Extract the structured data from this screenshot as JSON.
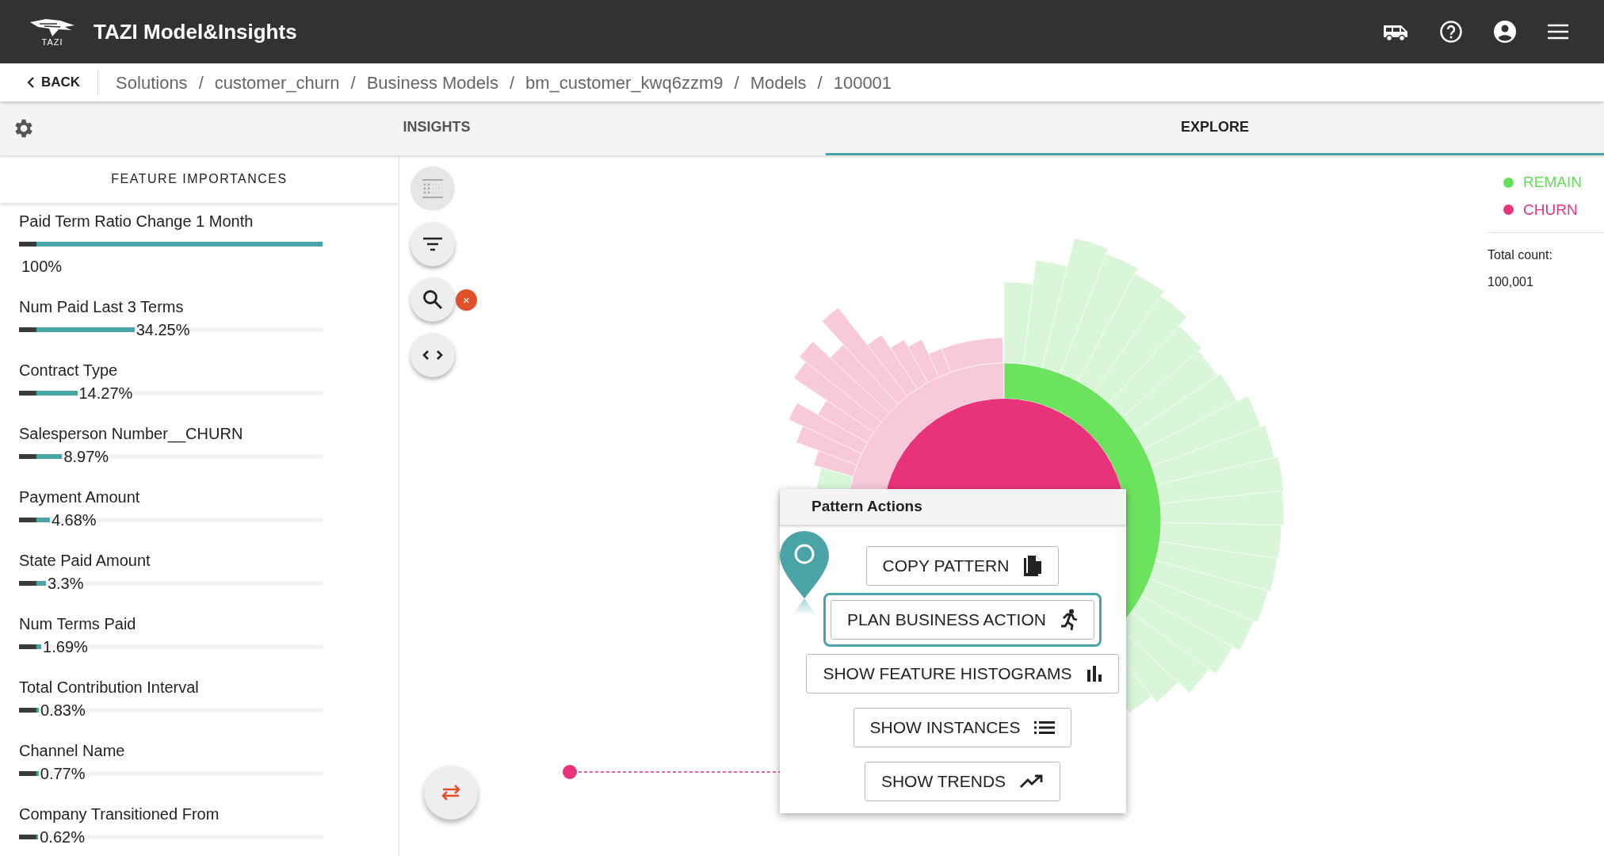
{
  "app": {
    "logo_text": "TAZI",
    "title": "TAZI Model&Insights"
  },
  "nav": {
    "back": "BACK",
    "separators": [
      "/",
      "/",
      "/",
      "/",
      "/"
    ],
    "breadcrumbs": [
      "Solutions",
      "customer_churn",
      "Business Models",
      "bm_customer_kwq6zzm9",
      "Models",
      "100001"
    ]
  },
  "tabs": [
    {
      "label": "INSIGHTS",
      "selected": false
    },
    {
      "label": "EXPLORE",
      "selected": true
    }
  ],
  "feature_importances": {
    "title": "FEATURE IMPORTANCES",
    "items": [
      {
        "name": "Paid Term Ratio Change 1 Month",
        "value": "100%",
        "level": 1
      },
      {
        "name": "Num Paid Last 3 Terms",
        "value": "34.25%",
        "level": 0.3425
      },
      {
        "name": "Contract Type",
        "value": "14.27%",
        "level": 0.1427
      },
      {
        "name": "Salesperson Number__CHURN",
        "value": "8.97%",
        "level": 0.0897
      },
      {
        "name": "Payment Amount",
        "value": "4.68%",
        "level": 0.0468
      },
      {
        "name": "State Paid Amount",
        "value": "3.3%",
        "level": 0.033
      },
      {
        "name": "Num Terms Paid",
        "value": "1.69%",
        "level": 0.0169
      },
      {
        "name": "Total Contribution Interval",
        "value": "0.83%",
        "level": 0.0083
      },
      {
        "name": "Channel Name",
        "value": "0.77%",
        "level": 0.0077
      },
      {
        "name": "Company Transitioned From",
        "value": "0.62%",
        "level": 0.0062
      }
    ]
  },
  "toolbar": {
    "search_clear": "×"
  },
  "legend": {
    "items": [
      {
        "label": "REMAIN",
        "color": "#63e05a"
      },
      {
        "label": "CHURN",
        "color": "#e8337a"
      }
    ],
    "total_label": "Total count:",
    "total_value": "100,001"
  },
  "pattern_actions": {
    "title": "Pattern Actions",
    "buttons": [
      {
        "label": "COPY PATTERN",
        "kind": "copy",
        "selected": false
      },
      {
        "label": "PLAN BUSINESS ACTION",
        "kind": "run",
        "selected": true
      },
      {
        "label": "SHOW FEATURE HISTOGRAMS",
        "kind": "histogram",
        "selected": false
      },
      {
        "label": "SHOW INSTANCES",
        "kind": "list",
        "selected": false
      },
      {
        "label": "SHOW TRENDS",
        "kind": "trend",
        "selected": false
      }
    ]
  }
}
